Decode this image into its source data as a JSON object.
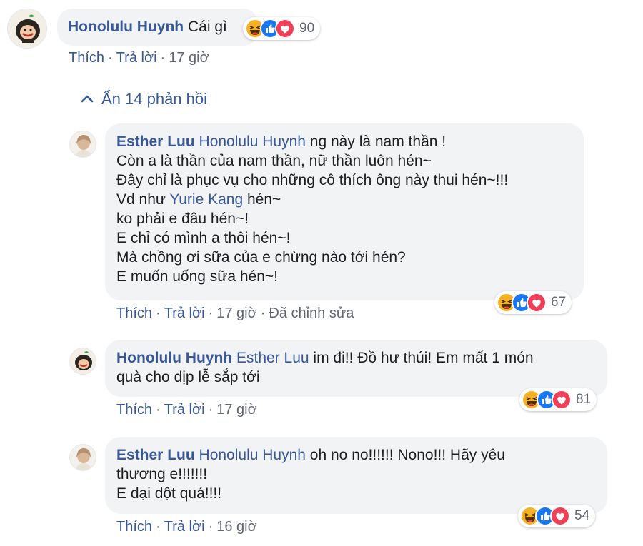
{
  "sep": "·",
  "colors": {
    "link": "#385898",
    "meta": "#606770",
    "bubble": "#f2f3f5",
    "like": "#1877f2",
    "love": "#f33e58",
    "haha": "#f7b125"
  },
  "top_comment": {
    "author": "Honolulu Huynh",
    "text": "Cái gì",
    "reaction_icons": [
      "haha-icon",
      "like-icon",
      "love-icon"
    ],
    "reaction_count": "90",
    "actions": {
      "like": "Thích",
      "reply": "Trả lời",
      "time": "17 giờ"
    }
  },
  "toggle_replies": {
    "icon": "chevron-up-icon",
    "label": "Ẩn 14 phản hồi"
  },
  "replies": [
    {
      "author": "Esther Luu",
      "mention": "Honolulu Huynh",
      "first_line": " ng này là nam thần !",
      "lines": [
        "Còn a là thần của nam thần, nữ thần luôn hén~",
        "Đây chỉ là phục vụ cho những cô thích ông này thui hén~!!!"
      ],
      "vd_prefix": "Vd như ",
      "vd_mention": "Yurie Kang",
      "vd_suffix": " hén~",
      "more_lines": [
        "ko phải e đâu hén~!",
        "E chỉ có mình a thôi hén~!",
        "Mà chồng ơi sữa của e chừng nào tới hén?",
        "E muốn uống sữa hén~!"
      ],
      "reaction_count": "67",
      "actions": {
        "like": "Thích",
        "reply": "Trả lời",
        "time": "17 giờ",
        "edited": "Đã chỉnh sửa"
      }
    },
    {
      "author": "Honolulu Huynh",
      "mention": "Esther Luu",
      "first_line": " im đi!! Đồ hư thúi! Em mất 1 món",
      "lines": [
        "quà cho dịp lễ sắp tới"
      ],
      "reaction_count": "81",
      "actions": {
        "like": "Thích",
        "reply": "Trả lời",
        "time": "17 giờ"
      }
    },
    {
      "author": "Esther Luu",
      "mention": "Honolulu Huynh",
      "first_line": " oh no no!!!!!! Nono!!! Hãy yêu",
      "lines": [
        "thương e!!!!!!!",
        "E dại dột quá!!!!"
      ],
      "reaction_count": "54",
      "actions": {
        "like": "Thích",
        "reply": "Trả lời",
        "time": "16 giờ"
      }
    }
  ]
}
